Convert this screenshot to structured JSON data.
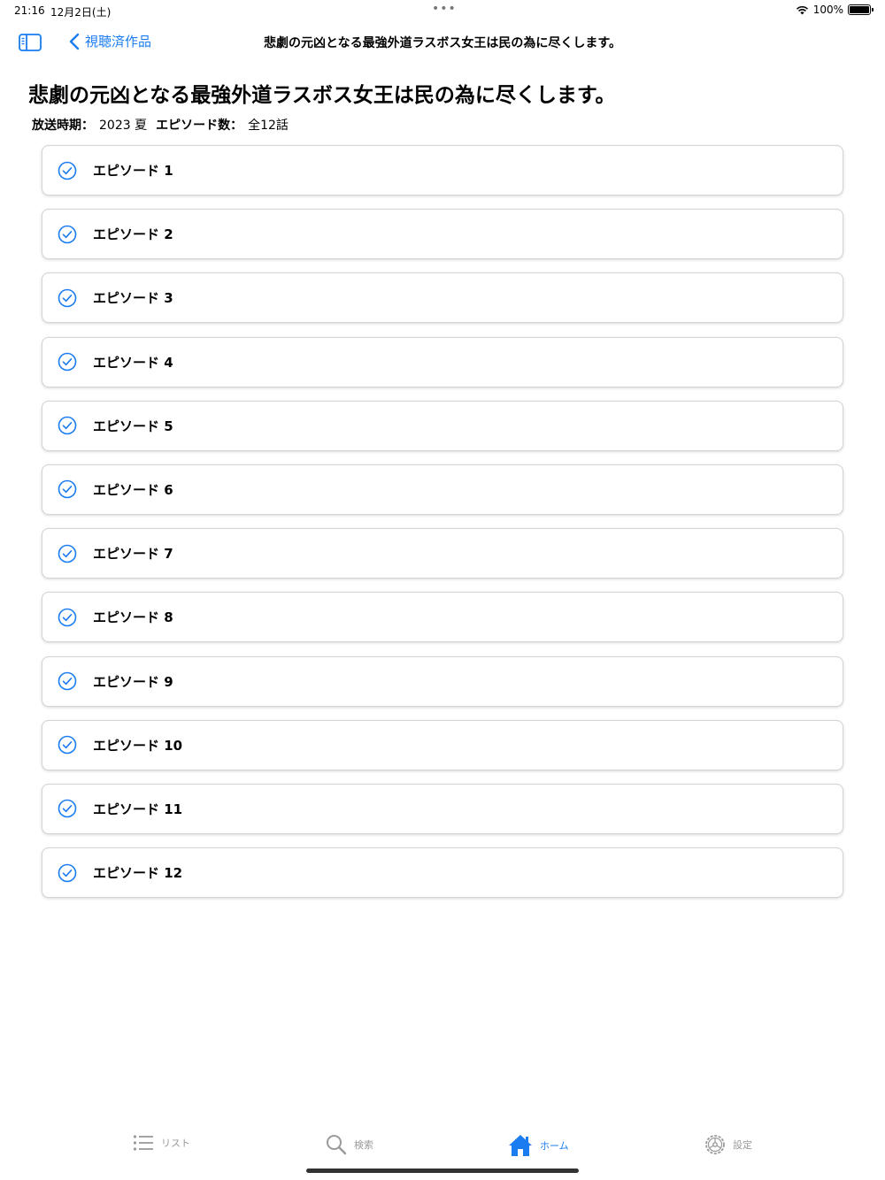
{
  "status_bar": {
    "time": "21:16",
    "date": "12月2日(土)",
    "battery": "100%"
  },
  "nav": {
    "back_label": "視聴済作品",
    "title": "悲劇の元凶となる最強外道ラスボス女王は民の為に尽くします。"
  },
  "page": {
    "title": "悲劇の元凶となる最強外道ラスボス女王は民の為に尽くします。",
    "broadcast_label": "放送時期：",
    "broadcast_value": "2023 夏",
    "episode_count_label": "エピソード数：",
    "episode_count_value": "全12話"
  },
  "episodes": [
    {
      "label": "エピソード 1",
      "watched": true
    },
    {
      "label": "エピソード 2",
      "watched": true
    },
    {
      "label": "エピソード 3",
      "watched": true
    },
    {
      "label": "エピソード 4",
      "watched": true
    },
    {
      "label": "エピソード 5",
      "watched": true
    },
    {
      "label": "エピソード 6",
      "watched": true
    },
    {
      "label": "エピソード 7",
      "watched": true
    },
    {
      "label": "エピソード 8",
      "watched": true
    },
    {
      "label": "エピソード 9",
      "watched": true
    },
    {
      "label": "エピソード 10",
      "watched": true
    },
    {
      "label": "エピソード 11",
      "watched": true
    },
    {
      "label": "エピソード 12",
      "watched": true
    }
  ],
  "tabs": [
    {
      "label": "リスト",
      "icon": "list-icon",
      "active": false
    },
    {
      "label": "検索",
      "icon": "search-icon",
      "active": false
    },
    {
      "label": "ホーム",
      "icon": "home-icon",
      "active": true
    },
    {
      "label": "設定",
      "icon": "gear-icon",
      "active": false
    }
  ],
  "colors": {
    "accent": "#1a7cf0",
    "inactive": "#9a9a9a"
  }
}
